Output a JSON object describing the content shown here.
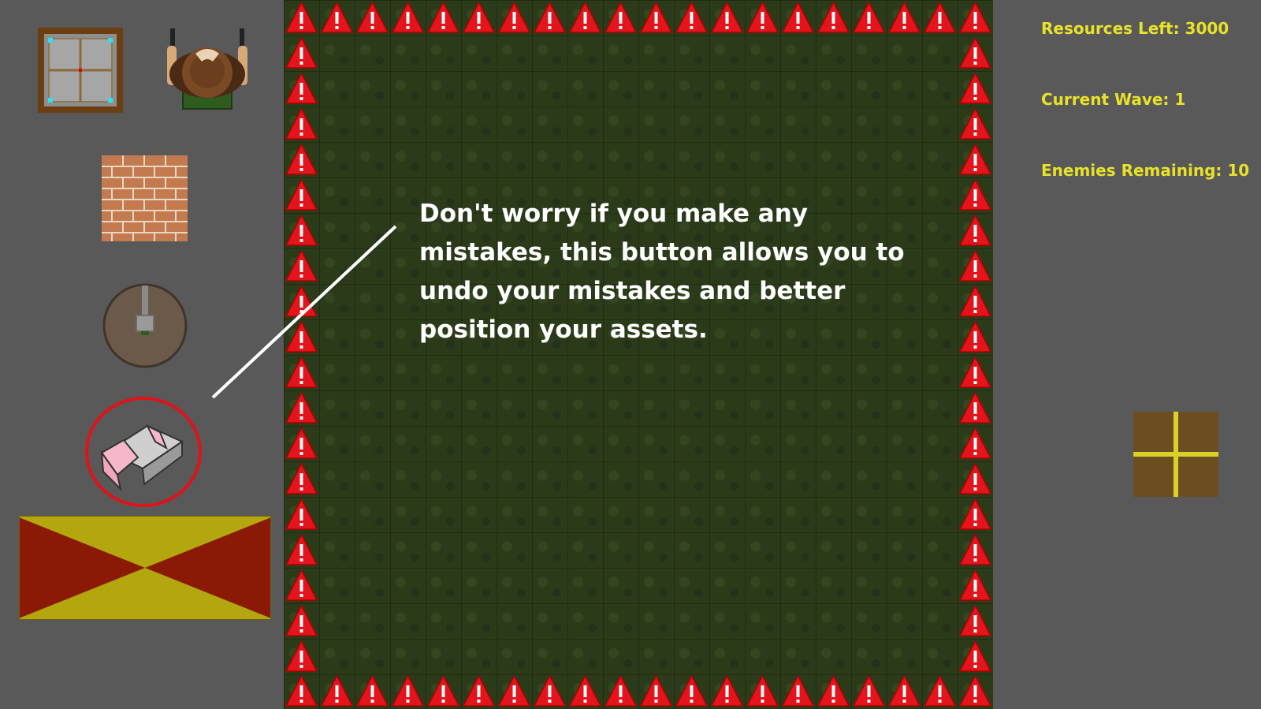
{
  "hud": {
    "resources": "Resources Left: 3000",
    "wave": "Current Wave: 1",
    "enemies": "Enemies Remaining: 10"
  },
  "tutorial": {
    "message": "Don't worry if you make any mistakes, this button allows you to undo your mistakes and better position your assets.",
    "highlighted_tool": "eraser-button"
  },
  "toolbar": {
    "items": [
      {
        "name": "window-frame-tool",
        "icon": "window-frame-icon"
      },
      {
        "name": "soldier-unit-tool",
        "icon": "soldier-icon"
      },
      {
        "name": "brick-wall-tool",
        "icon": "brick-wall-icon"
      },
      {
        "name": "turret-tool",
        "icon": "turret-icon"
      },
      {
        "name": "eraser-button",
        "icon": "eraser-icon"
      },
      {
        "name": "start-wave-button",
        "icon": "hourglass-flag-icon"
      }
    ]
  },
  "colors": {
    "hud_text": "#e8e32a",
    "warning_red": "#e3141c",
    "highlight_ring": "#e0121a",
    "background": "#595959"
  }
}
